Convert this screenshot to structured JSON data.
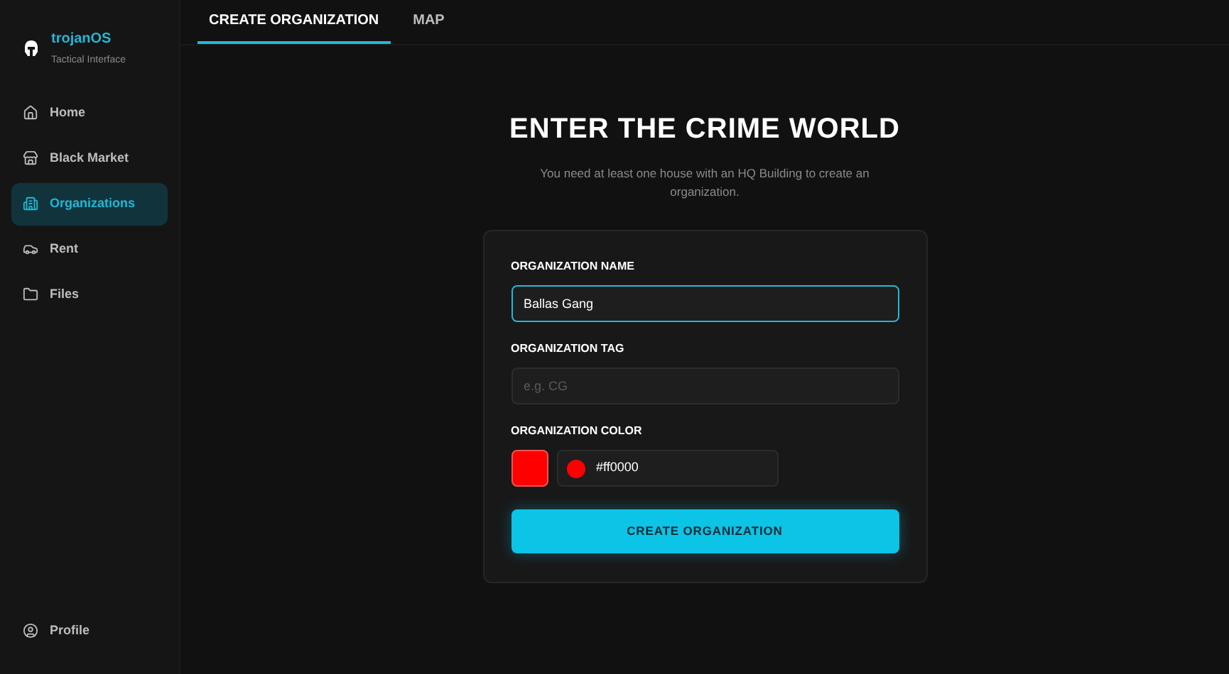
{
  "brand": {
    "name": "trojanOS",
    "subtitle": "Tactical Interface"
  },
  "sidebar": {
    "items": [
      {
        "label": "Home",
        "selected": false
      },
      {
        "label": "Black Market",
        "selected": false
      },
      {
        "label": "Organizations",
        "selected": true
      },
      {
        "label": "Rent",
        "selected": false
      },
      {
        "label": "Files",
        "selected": false
      }
    ],
    "footer": {
      "label": "Profile"
    }
  },
  "tabs": [
    {
      "label": "CREATE ORGANIZATION",
      "selected": true
    },
    {
      "label": "MAP",
      "selected": false
    }
  ],
  "heading": "ENTER THE CRIME WORLD",
  "subtitle": "You need at least one house with an HQ Building to create an organization.",
  "form": {
    "name": {
      "label": "ORGANIZATION NAME",
      "value": "Ballas Gang",
      "focused": true
    },
    "tag": {
      "label": "ORGANIZATION TAG",
      "placeholder": "e.g. CG"
    },
    "color": {
      "label": "ORGANIZATION COLOR",
      "value": "#ff0000",
      "color": "#ff0000"
    },
    "submit": "CREATE ORGANIZATION"
  }
}
